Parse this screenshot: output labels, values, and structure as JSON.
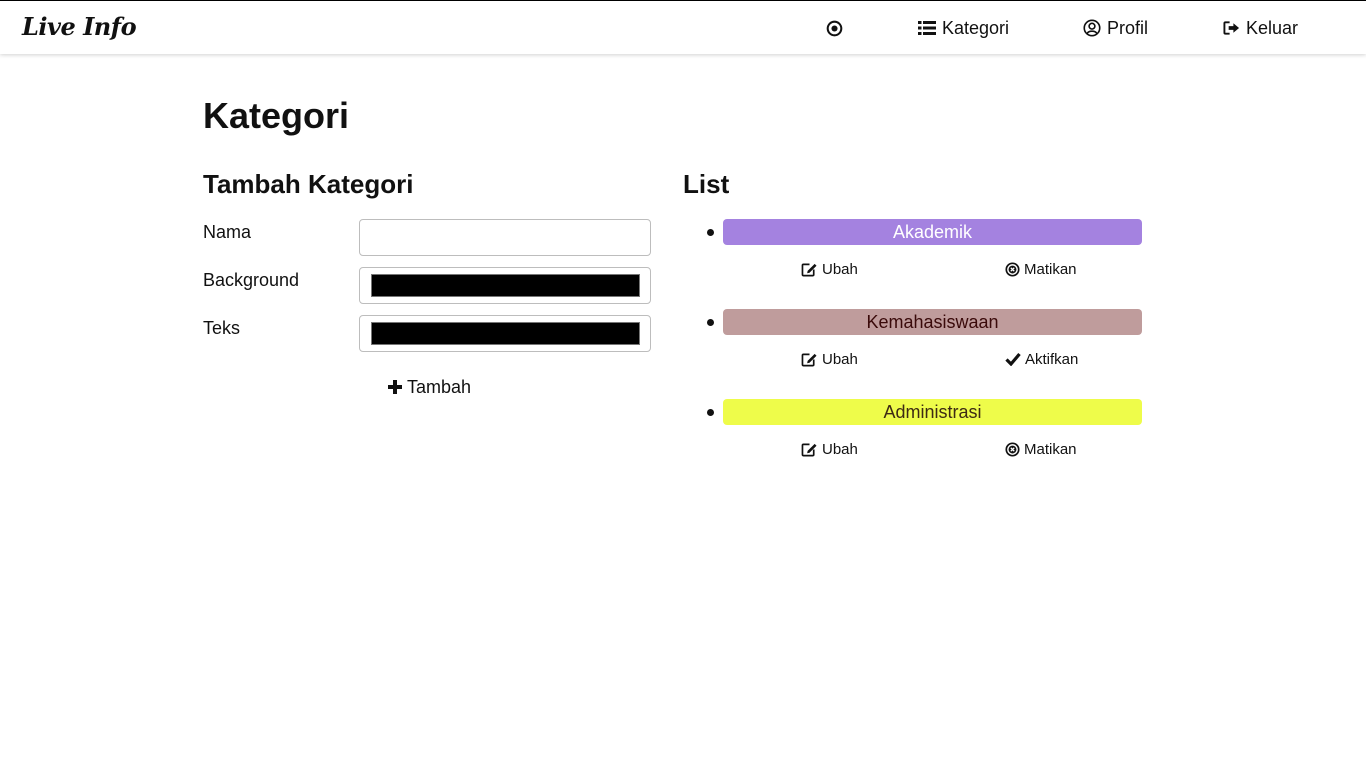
{
  "app": {
    "brand": "Live Info"
  },
  "nav": {
    "home_icon": "dot-circle-icon",
    "kategori_label": "Kategori",
    "profil_label": "Profil",
    "keluar_label": "Keluar"
  },
  "page": {
    "title": "Kategori"
  },
  "form": {
    "title": "Tambah Kategori",
    "nama_label": "Nama",
    "nama_value": "",
    "background_label": "Background",
    "background_value": "#000000",
    "teks_label": "Teks",
    "teks_value": "#000000",
    "submit_label": "Tambah"
  },
  "list": {
    "title": "List",
    "items": [
      {
        "name": "Akademik",
        "bg": "#a482e0",
        "fg": "#ffffff",
        "edit_label": "Ubah",
        "toggle_label": "Matikan",
        "toggle_icon": "times-circle-icon"
      },
      {
        "name": "Kemahasiswaan",
        "bg": "#bf9c9c",
        "fg": "#3a0a0a",
        "edit_label": "Ubah",
        "toggle_label": "Aktifkan",
        "toggle_icon": "check-icon"
      },
      {
        "name": "Administrasi",
        "bg": "#eefc4a",
        "fg": "#3d2a14",
        "edit_label": "Ubah",
        "toggle_label": "Matikan",
        "toggle_icon": "times-circle-icon"
      }
    ]
  }
}
